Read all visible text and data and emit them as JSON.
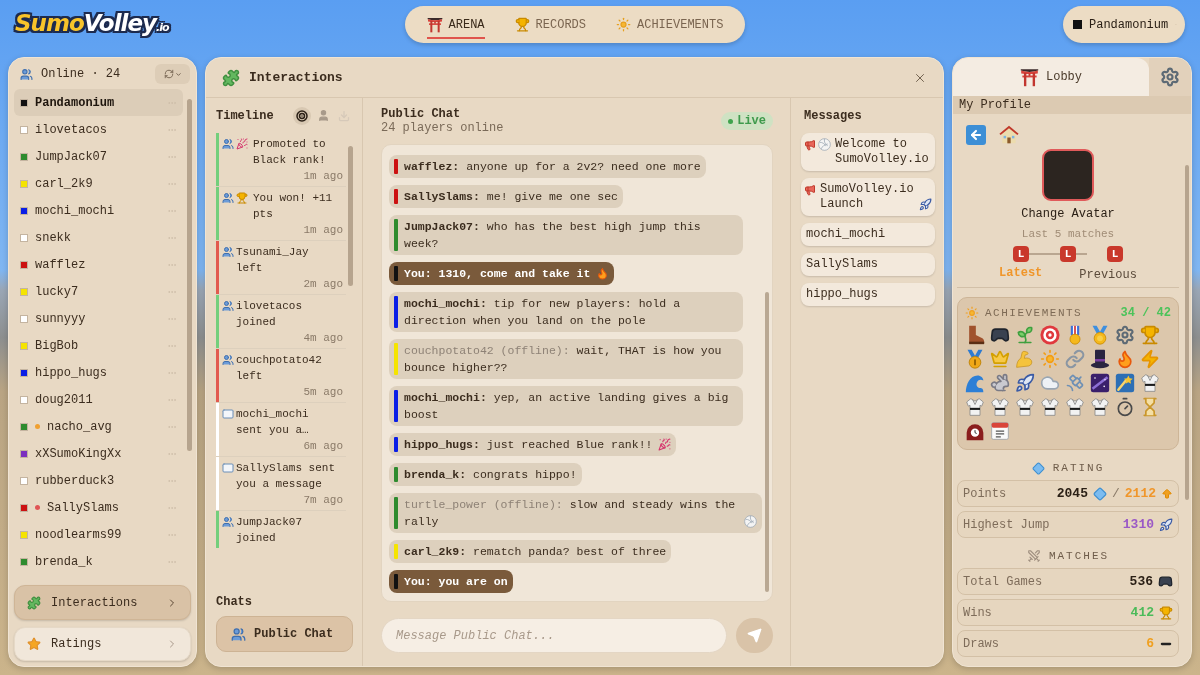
{
  "logo": {
    "main": "Sumo",
    "second": "Volley",
    "suffix": ".io"
  },
  "nav": {
    "tabs": [
      {
        "label": "ARENA",
        "kind": "arena",
        "selected": true
      },
      {
        "label": "RECORDS",
        "kind": "records",
        "selected": false
      },
      {
        "label": "ACHIEVEMENTS",
        "kind": "achievements",
        "selected": false
      }
    ]
  },
  "account": {
    "name": "Pandamonium",
    "color": "#111111"
  },
  "online": {
    "title": "Online · 24",
    "users": [
      {
        "name": "Pandamonium",
        "color": "#111111",
        "selected": true
      },
      {
        "name": "ilovetacos",
        "color": "#ffffff",
        "selected": false
      },
      {
        "name": "JumpJack07",
        "color": "#2e8b2e",
        "selected": false
      },
      {
        "name": "carl_2k9",
        "color": "#f5e400",
        "selected": false
      },
      {
        "name": "mochi_mochi",
        "color": "#0a1ee6",
        "selected": false
      },
      {
        "name": "snekk",
        "color": "#ffffff",
        "selected": false
      },
      {
        "name": "wafflez",
        "color": "#cc1111",
        "selected": false
      },
      {
        "name": "lucky7",
        "color": "#f5e400",
        "selected": false
      },
      {
        "name": "sunnyyy",
        "color": "#ffffff",
        "selected": false
      },
      {
        "name": "BigBob",
        "color": "#f5e400",
        "selected": false
      },
      {
        "name": "hippo_hugs",
        "color": "#0a1ee6",
        "selected": false
      },
      {
        "name": "doug2011",
        "color": "#ffffff",
        "selected": false
      },
      {
        "name": "nacho_avg",
        "color": "#2e8b2e",
        "status": {
          "color": "#f0a030"
        },
        "selected": false
      },
      {
        "name": "xXSumoKingXx",
        "color": "#7b2fbf",
        "selected": false
      },
      {
        "name": "rubberduck3",
        "color": "#ffffff",
        "selected": false
      },
      {
        "name": "SallySlams",
        "color": "#cc1111",
        "status": {
          "color": "#e05555"
        },
        "selected": false
      },
      {
        "name": "noodlearms99",
        "color": "#f5e400",
        "selected": false
      },
      {
        "name": "brenda_k",
        "color": "#2e8b2e",
        "selected": false
      }
    ]
  },
  "side_nav": [
    {
      "label": "Interactions",
      "kind": "interactions",
      "selected": true
    },
    {
      "label": "Ratings",
      "kind": "ratings",
      "selected": false
    }
  ],
  "interactions": {
    "title": "Interactions",
    "timeline": {
      "title": "Timeline",
      "filters": [
        {
          "kind": "all",
          "selected": true,
          "disabled": false
        },
        {
          "kind": "people",
          "selected": false,
          "disabled": false
        },
        {
          "kind": "inbox",
          "selected": false,
          "disabled": true
        }
      ],
      "events": [
        {
          "kind": "promotion",
          "color": "#74cf7c",
          "text": "Promoted to Black rank!",
          "time": "1m ago"
        },
        {
          "kind": "win",
          "color": "#74cf7c",
          "text": "You won! +11 pts",
          "time": "1m ago"
        },
        {
          "kind": "left",
          "color": "#e25a4f",
          "text": "Tsunami_Jay left",
          "time": "2m ago"
        },
        {
          "kind": "joined",
          "color": "#74cf7c",
          "text": "ilovetacos joined",
          "time": "4m ago"
        },
        {
          "kind": "left",
          "color": "#e25a4f",
          "text": "couchpotato42 left",
          "time": "5m ago"
        },
        {
          "kind": "message",
          "color": "#ffffff",
          "text": "mochi_mochi sent you a…",
          "time": "6m ago"
        },
        {
          "kind": "message",
          "color": "#ffffff",
          "text": "SallySlams sent you a message",
          "time": "7m ago"
        },
        {
          "kind": "joined",
          "color": "#74cf7c",
          "text": "JumpJack07 joined"
        }
      ]
    },
    "chats": {
      "title": "Chats",
      "items": [
        {
          "label": "Public Chat",
          "selected": true
        }
      ]
    },
    "chat": {
      "title": "Public Chat",
      "subtitle": "24 players online",
      "status": "Live",
      "messages": [
        {
          "kind": "user",
          "author": "wafflez:",
          "text": "anyone up for a 2v2? need one more",
          "color": "#cc1111",
          "online": true
        },
        {
          "kind": "user",
          "author": "SallySlams:",
          "text": "me! give me one sec",
          "color": "#cc1111",
          "online": true
        },
        {
          "kind": "user",
          "author": "JumpJack07:",
          "text": "who has the best high jump this week?",
          "color": "#2e8b2e",
          "online": true
        },
        {
          "kind": "self",
          "author": "You:",
          "text": "1310, come and take it",
          "color": "#111111",
          "online": true,
          "end_icon": {
            "kind": "fire"
          }
        },
        {
          "kind": "user",
          "author": "mochi_mochi:",
          "text": "tip for new players: hold a direction when you land on the pole",
          "color": "#0a1ee6",
          "online": true
        },
        {
          "kind": "user",
          "author": "couchpotato42 (offline):",
          "text": "wait, THAT is how you bounce higher??",
          "color": "#f5e400",
          "online": false
        },
        {
          "kind": "user",
          "author": "mochi_mochi:",
          "text": "yep, an active landing gives a big boost",
          "color": "#0a1ee6",
          "online": true
        },
        {
          "kind": "user",
          "author": "hippo_hugs:",
          "text": "just reached Blue rank!!",
          "color": "#0a1ee6",
          "online": true,
          "end_icon": {
            "kind": "party"
          }
        },
        {
          "kind": "user",
          "author": "brenda_k:",
          "text": "congrats hippo!",
          "color": "#2e8b2e",
          "online": true
        },
        {
          "kind": "user",
          "author": "turtle_power (offline):",
          "text": "slow and steady wins the rally",
          "color": "#2e8b2e",
          "online": false,
          "end_icon": {
            "kind": "volleyball"
          }
        },
        {
          "kind": "user",
          "author": "carl_2k9:",
          "text": "rematch panda? best of three",
          "color": "#f5e400",
          "online": true
        },
        {
          "kind": "self",
          "author": "You:",
          "text": "you are on",
          "color": "#111111",
          "online": true
        }
      ],
      "input": {
        "placeholder": "Message Public Chat..."
      }
    },
    "inbox": {
      "title": "Messages",
      "items": [
        {
          "kind": "announcement",
          "text": "Welcome to SumoVolley.io",
          "start_icon": {
            "kind": "volleyball"
          }
        },
        {
          "kind": "announcement",
          "text": "SumoVolley.io Launch",
          "end_icon": {
            "kind": "rocket"
          }
        },
        {
          "kind": "direct",
          "text": "mochi_mochi"
        },
        {
          "kind": "direct",
          "text": "SallySlams"
        },
        {
          "kind": "direct",
          "text": "hippo_hugs"
        }
      ]
    }
  },
  "lobby": {
    "tabs": [
      {
        "label": "Lobby",
        "kind": "lobby",
        "selected": true
      },
      {
        "kind": "settings",
        "selected": false
      }
    ],
    "profile": {
      "title": "My Profile",
      "avatar_action": "Change Avatar",
      "matches_label": "Last 5 matches",
      "results": [
        {
          "text": "L",
          "kind": "loss"
        },
        {
          "text": "L",
          "kind": "loss"
        },
        {
          "text": "L",
          "kind": "loss"
        }
      ],
      "latest_label": "Latest",
      "previous_label": "Previous"
    },
    "achievements": {
      "title": "ACHIEVEMENTS",
      "count": "34 / 42",
      "badges": [
        {
          "kind": "boot"
        },
        {
          "kind": "gamepad"
        },
        {
          "kind": "sprout"
        },
        {
          "kind": "target"
        },
        {
          "kind": "militarymedal"
        },
        {
          "kind": "sportsmedal"
        },
        {
          "kind": "gear"
        },
        {
          "kind": "trophy"
        },
        {
          "kind": "firstmedal"
        },
        {
          "kind": "crown"
        },
        {
          "kind": "biceps"
        },
        {
          "kind": "sun"
        },
        {
          "kind": "chain"
        },
        {
          "kind": "tophat"
        },
        {
          "kind": "fire"
        },
        {
          "kind": "lightning"
        },
        {
          "kind": "wave"
        },
        {
          "kind": "rabbit"
        },
        {
          "kind": "rocket"
        },
        {
          "kind": "cloud"
        },
        {
          "kind": "satellite"
        },
        {
          "kind": "nightsky"
        },
        {
          "kind": "comet"
        },
        {
          "kind": "gi"
        },
        {
          "kind": "gi"
        },
        {
          "kind": "gi"
        },
        {
          "kind": "gi"
        },
        {
          "kind": "gi"
        },
        {
          "kind": "gi"
        },
        {
          "kind": "gi"
        },
        {
          "kind": "stopwatch"
        },
        {
          "kind": "hourglass"
        },
        {
          "kind": "mantelclock"
        },
        {
          "kind": "calendar"
        }
      ]
    },
    "rating": {
      "title": "RATING",
      "rows": [
        {
          "kind": "points",
          "label": "Points",
          "value": "2045",
          "color": "#2b2016",
          "separator": "/",
          "best": "2112"
        },
        {
          "kind": "jump",
          "label": "Highest Jump",
          "value": "1310",
          "color": "#9b59c6"
        }
      ]
    },
    "matches": {
      "title": "MATCHES",
      "rows": [
        {
          "kind": "games",
          "label": "Total Games",
          "value": "536",
          "color": "#2b2016"
        },
        {
          "kind": "wins",
          "label": "Wins",
          "value": "412",
          "color": "#4cbb5a"
        },
        {
          "kind": "draws",
          "label": "Draws",
          "value": "6",
          "color": "#f0a020"
        }
      ]
    }
  }
}
